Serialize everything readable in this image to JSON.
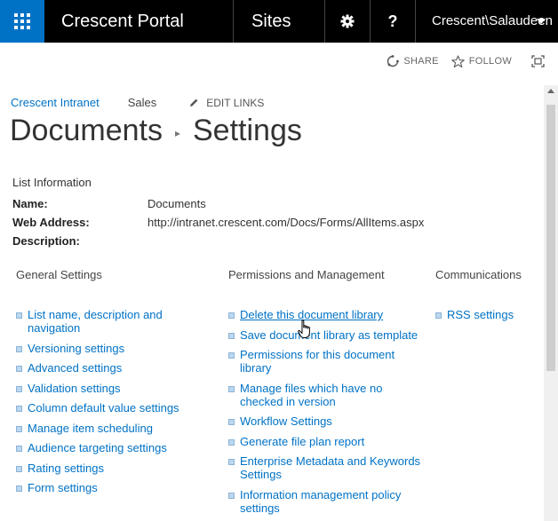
{
  "suitebar": {
    "brand": "Crescent Portal",
    "sites": "Sites",
    "help": "?",
    "user": "Crescent\\Salaudeen"
  },
  "actions": {
    "share": "SHARE",
    "follow": "FOLLOW"
  },
  "topnav": {
    "home": "Crescent Intranet",
    "sales": "Sales",
    "edit_links": "EDIT LINKS"
  },
  "title": {
    "list": "Documents",
    "page": "Settings"
  },
  "list_info": {
    "heading": "List Information",
    "rows": [
      {
        "label": "Name:",
        "value": "Documents"
      },
      {
        "label": "Web Address:",
        "value": "http://intranet.crescent.com/Docs/Forms/AllItems.aspx"
      },
      {
        "label": "Description:",
        "value": ""
      }
    ]
  },
  "general": {
    "heading": "General Settings",
    "links": [
      "List name, description and navigation",
      "Versioning settings",
      "Advanced settings",
      "Validation settings",
      "Column default value settings",
      "Manage item scheduling",
      "Audience targeting settings",
      "Rating settings",
      "Form settings"
    ]
  },
  "permissions": {
    "heading": "Permissions and Management",
    "links": [
      "Delete this document library",
      "Save document library as template",
      "Permissions for this document library",
      "Manage files which have no checked in version",
      "Workflow Settings",
      "Generate file plan report",
      "Enterprise Metadata and Keywords Settings",
      "Information management policy settings"
    ]
  },
  "communications": {
    "heading": "Communications",
    "links": [
      "RSS settings"
    ]
  },
  "colors": {
    "accent": "#0072c6",
    "suitebar": "#000000",
    "link": "#0072c6"
  }
}
